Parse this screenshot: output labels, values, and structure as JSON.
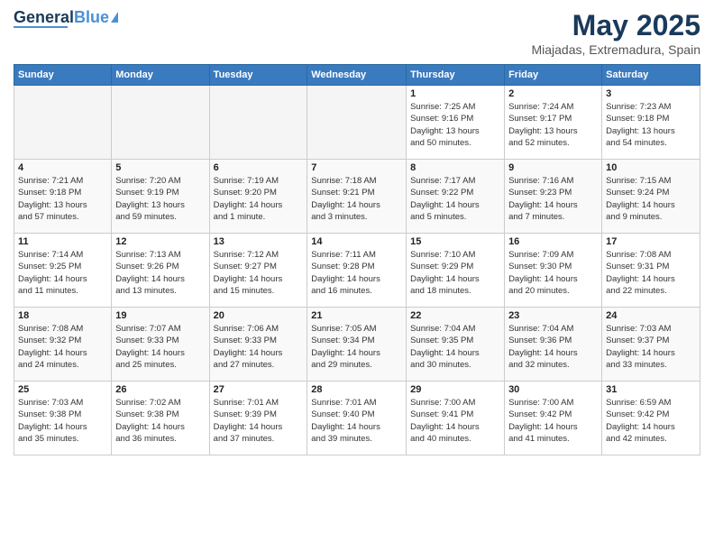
{
  "header": {
    "logo_general": "General",
    "logo_blue": "Blue",
    "title": "May 2025",
    "subtitle": "Miajadas, Extremadura, Spain"
  },
  "calendar": {
    "days_of_week": [
      "Sunday",
      "Monday",
      "Tuesday",
      "Wednesday",
      "Thursday",
      "Friday",
      "Saturday"
    ],
    "weeks": [
      [
        {
          "day": "",
          "info": ""
        },
        {
          "day": "",
          "info": ""
        },
        {
          "day": "",
          "info": ""
        },
        {
          "day": "",
          "info": ""
        },
        {
          "day": "1",
          "info": "Sunrise: 7:25 AM\nSunset: 9:16 PM\nDaylight: 13 hours\nand 50 minutes."
        },
        {
          "day": "2",
          "info": "Sunrise: 7:24 AM\nSunset: 9:17 PM\nDaylight: 13 hours\nand 52 minutes."
        },
        {
          "day": "3",
          "info": "Sunrise: 7:23 AM\nSunset: 9:18 PM\nDaylight: 13 hours\nand 54 minutes."
        }
      ],
      [
        {
          "day": "4",
          "info": "Sunrise: 7:21 AM\nSunset: 9:18 PM\nDaylight: 13 hours\nand 57 minutes."
        },
        {
          "day": "5",
          "info": "Sunrise: 7:20 AM\nSunset: 9:19 PM\nDaylight: 13 hours\nand 59 minutes."
        },
        {
          "day": "6",
          "info": "Sunrise: 7:19 AM\nSunset: 9:20 PM\nDaylight: 14 hours\nand 1 minute."
        },
        {
          "day": "7",
          "info": "Sunrise: 7:18 AM\nSunset: 9:21 PM\nDaylight: 14 hours\nand 3 minutes."
        },
        {
          "day": "8",
          "info": "Sunrise: 7:17 AM\nSunset: 9:22 PM\nDaylight: 14 hours\nand 5 minutes."
        },
        {
          "day": "9",
          "info": "Sunrise: 7:16 AM\nSunset: 9:23 PM\nDaylight: 14 hours\nand 7 minutes."
        },
        {
          "day": "10",
          "info": "Sunrise: 7:15 AM\nSunset: 9:24 PM\nDaylight: 14 hours\nand 9 minutes."
        }
      ],
      [
        {
          "day": "11",
          "info": "Sunrise: 7:14 AM\nSunset: 9:25 PM\nDaylight: 14 hours\nand 11 minutes."
        },
        {
          "day": "12",
          "info": "Sunrise: 7:13 AM\nSunset: 9:26 PM\nDaylight: 14 hours\nand 13 minutes."
        },
        {
          "day": "13",
          "info": "Sunrise: 7:12 AM\nSunset: 9:27 PM\nDaylight: 14 hours\nand 15 minutes."
        },
        {
          "day": "14",
          "info": "Sunrise: 7:11 AM\nSunset: 9:28 PM\nDaylight: 14 hours\nand 16 minutes."
        },
        {
          "day": "15",
          "info": "Sunrise: 7:10 AM\nSunset: 9:29 PM\nDaylight: 14 hours\nand 18 minutes."
        },
        {
          "day": "16",
          "info": "Sunrise: 7:09 AM\nSunset: 9:30 PM\nDaylight: 14 hours\nand 20 minutes."
        },
        {
          "day": "17",
          "info": "Sunrise: 7:08 AM\nSunset: 9:31 PM\nDaylight: 14 hours\nand 22 minutes."
        }
      ],
      [
        {
          "day": "18",
          "info": "Sunrise: 7:08 AM\nSunset: 9:32 PM\nDaylight: 14 hours\nand 24 minutes."
        },
        {
          "day": "19",
          "info": "Sunrise: 7:07 AM\nSunset: 9:33 PM\nDaylight: 14 hours\nand 25 minutes."
        },
        {
          "day": "20",
          "info": "Sunrise: 7:06 AM\nSunset: 9:33 PM\nDaylight: 14 hours\nand 27 minutes."
        },
        {
          "day": "21",
          "info": "Sunrise: 7:05 AM\nSunset: 9:34 PM\nDaylight: 14 hours\nand 29 minutes."
        },
        {
          "day": "22",
          "info": "Sunrise: 7:04 AM\nSunset: 9:35 PM\nDaylight: 14 hours\nand 30 minutes."
        },
        {
          "day": "23",
          "info": "Sunrise: 7:04 AM\nSunset: 9:36 PM\nDaylight: 14 hours\nand 32 minutes."
        },
        {
          "day": "24",
          "info": "Sunrise: 7:03 AM\nSunset: 9:37 PM\nDaylight: 14 hours\nand 33 minutes."
        }
      ],
      [
        {
          "day": "25",
          "info": "Sunrise: 7:03 AM\nSunset: 9:38 PM\nDaylight: 14 hours\nand 35 minutes."
        },
        {
          "day": "26",
          "info": "Sunrise: 7:02 AM\nSunset: 9:38 PM\nDaylight: 14 hours\nand 36 minutes."
        },
        {
          "day": "27",
          "info": "Sunrise: 7:01 AM\nSunset: 9:39 PM\nDaylight: 14 hours\nand 37 minutes."
        },
        {
          "day": "28",
          "info": "Sunrise: 7:01 AM\nSunset: 9:40 PM\nDaylight: 14 hours\nand 39 minutes."
        },
        {
          "day": "29",
          "info": "Sunrise: 7:00 AM\nSunset: 9:41 PM\nDaylight: 14 hours\nand 40 minutes."
        },
        {
          "day": "30",
          "info": "Sunrise: 7:00 AM\nSunset: 9:42 PM\nDaylight: 14 hours\nand 41 minutes."
        },
        {
          "day": "31",
          "info": "Sunrise: 6:59 AM\nSunset: 9:42 PM\nDaylight: 14 hours\nand 42 minutes."
        }
      ]
    ]
  }
}
